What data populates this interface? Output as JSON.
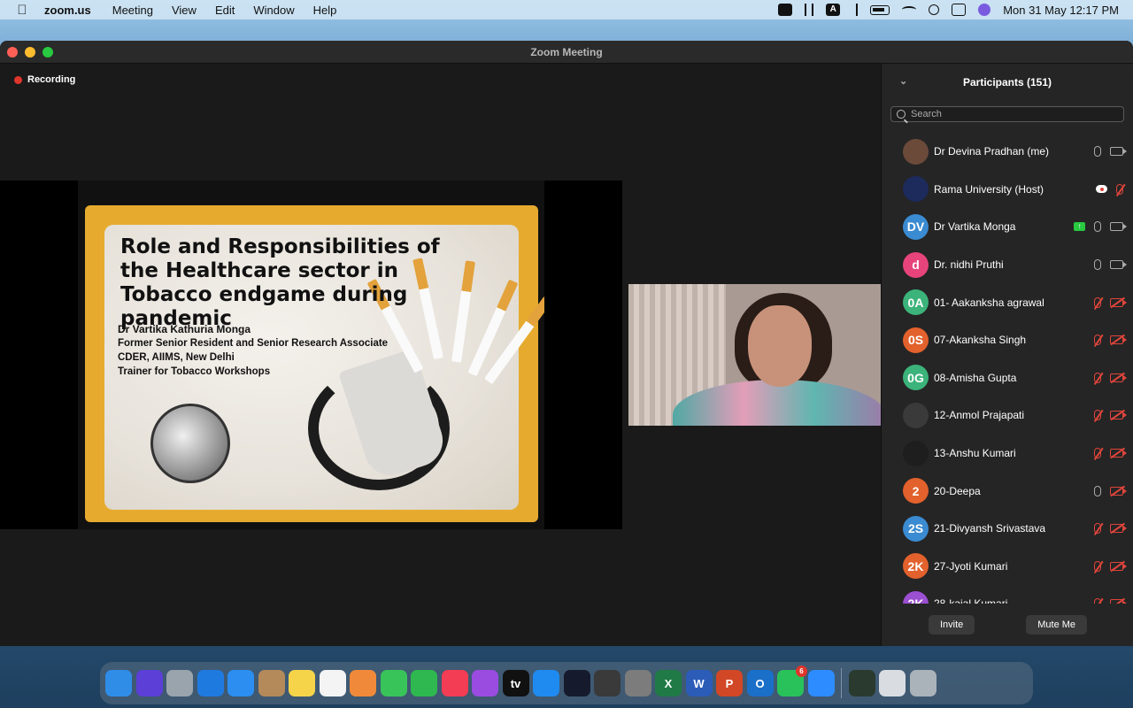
{
  "menubar": {
    "app_name": "zoom.us",
    "menus": [
      "Meeting",
      "View",
      "Edit",
      "Window",
      "Help"
    ],
    "clock": "Mon 31 May  12:17 PM",
    "input_indicator": "A"
  },
  "window": {
    "title": "Zoom Meeting"
  },
  "meeting": {
    "recording_label": "Recording",
    "slide": {
      "title": "Role and Responsibilities of the Healthcare sector in Tobacco endgame during pandemic",
      "lines": [
        "Dr Vartika Kathuria Monga",
        "Former Senior Resident and Senior Research Associate",
        "CDER, AIIMS, New Delhi",
        "Trainer for Tobacco Workshops"
      ]
    }
  },
  "participants": {
    "title": "Participants (151)",
    "search_placeholder": "Search",
    "items": [
      {
        "name": "Dr Devina Pradhan (me)",
        "initials": "",
        "color": "#6b4a3a",
        "mic": "on",
        "cam": "on",
        "extra": ""
      },
      {
        "name": "Rama University (Host)",
        "initials": "",
        "color": "#1d2a5c",
        "mic": "muted",
        "cam": "none",
        "extra": "cloud"
      },
      {
        "name": "Dr Vartika Monga",
        "initials": "DV",
        "color": "#3a8bd1",
        "mic": "on",
        "cam": "on",
        "extra": "share"
      },
      {
        "name": "Dr. nidhi Pruthi",
        "initials": "d",
        "color": "#e6447a",
        "mic": "on",
        "cam": "on",
        "extra": ""
      },
      {
        "name": "01- Aakanksha agrawal",
        "initials": "0A",
        "color": "#3bb37a",
        "mic": "muted",
        "cam": "off",
        "extra": ""
      },
      {
        "name": "07-Akanksha Singh",
        "initials": "0S",
        "color": "#e2612c",
        "mic": "muted",
        "cam": "off",
        "extra": ""
      },
      {
        "name": "08-Amisha Gupta",
        "initials": "0G",
        "color": "#3bb37a",
        "mic": "muted",
        "cam": "off",
        "extra": ""
      },
      {
        "name": "12-Anmol Prajapati",
        "initials": "",
        "color": "#3a3a3a",
        "mic": "muted",
        "cam": "off",
        "extra": ""
      },
      {
        "name": "13-Anshu Kumari",
        "initials": "",
        "color": "#1e1e1e",
        "mic": "muted",
        "cam": "off",
        "extra": ""
      },
      {
        "name": "20-Deepa",
        "initials": "2",
        "color": "#e2612c",
        "mic": "on",
        "cam": "off",
        "extra": ""
      },
      {
        "name": "21-Divyansh Srivastava",
        "initials": "2S",
        "color": "#3a8bd1",
        "mic": "muted",
        "cam": "off",
        "extra": ""
      },
      {
        "name": "27-Jyoti Kumari",
        "initials": "2K",
        "color": "#e2612c",
        "mic": "muted",
        "cam": "off",
        "extra": ""
      },
      {
        "name": "28-kajal Kumari",
        "initials": "2K",
        "color": "#9b4fd1",
        "mic": "muted",
        "cam": "off",
        "extra": ""
      }
    ],
    "invite_label": "Invite",
    "mute_me_label": "Mute Me"
  },
  "dock": {
    "apps": [
      {
        "name": "finder",
        "color": "#2f8de8",
        "glyph": ""
      },
      {
        "name": "siri",
        "color": "#5b3fd6",
        "glyph": ""
      },
      {
        "name": "launchpad",
        "color": "#9aa4ad",
        "glyph": ""
      },
      {
        "name": "safari",
        "color": "#1f7ae0",
        "glyph": ""
      },
      {
        "name": "mail",
        "color": "#2b8ef0",
        "glyph": ""
      },
      {
        "name": "contacts",
        "color": "#b58a5a",
        "glyph": ""
      },
      {
        "name": "notes",
        "color": "#f5d44a",
        "glyph": ""
      },
      {
        "name": "reminders",
        "color": "#f4f4f4",
        "glyph": ""
      },
      {
        "name": "photos",
        "color": "#f08a3a",
        "glyph": ""
      },
      {
        "name": "messages",
        "color": "#39c45a",
        "glyph": ""
      },
      {
        "name": "facetime",
        "color": "#2fb84f",
        "glyph": ""
      },
      {
        "name": "music",
        "color": "#f23d54",
        "glyph": ""
      },
      {
        "name": "podcasts",
        "color": "#9a4be0",
        "glyph": ""
      },
      {
        "name": "apple-tv",
        "color": "#111111",
        "glyph": "tv"
      },
      {
        "name": "app-store",
        "color": "#1f8bf0",
        "glyph": ""
      },
      {
        "name": "speedtest",
        "color": "#151a2c",
        "glyph": ""
      },
      {
        "name": "screenshot",
        "color": "#3a3a3a",
        "glyph": ""
      },
      {
        "name": "system-preferences",
        "color": "#7c7c7c",
        "glyph": ""
      },
      {
        "name": "excel",
        "color": "#1f7a45",
        "glyph": "X"
      },
      {
        "name": "word",
        "color": "#2b5cb8",
        "glyph": "W"
      },
      {
        "name": "powerpoint",
        "color": "#d24726",
        "glyph": "P"
      },
      {
        "name": "outlook",
        "color": "#1a6fc9",
        "glyph": "O"
      },
      {
        "name": "whatsapp",
        "color": "#29c25a",
        "glyph": "",
        "badge": "6"
      },
      {
        "name": "zoom",
        "color": "#2d8cff",
        "glyph": ""
      }
    ],
    "trailing": [
      {
        "name": "activity-monitor",
        "color": "#2a3a2f"
      },
      {
        "name": "downloads-stack",
        "color": "#d9dde2"
      },
      {
        "name": "trash",
        "color": "#aab2ba"
      }
    ]
  }
}
